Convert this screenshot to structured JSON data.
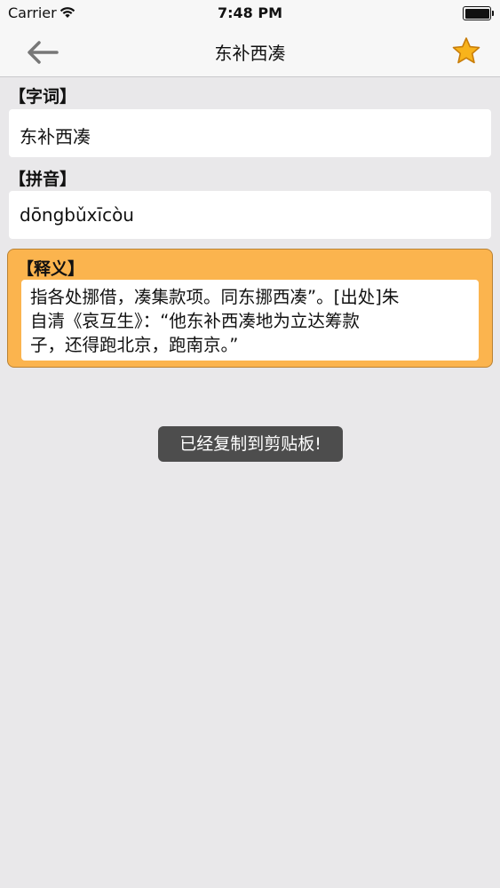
{
  "status_bar": {
    "carrier": "Carrier",
    "time": "7:48 PM"
  },
  "nav": {
    "title": "东补西凑",
    "back_icon": "back-arrow-icon",
    "star_icon": "star-icon",
    "star_color": "#f5a623"
  },
  "word": {
    "label": "【字词】",
    "value": "东补西凑"
  },
  "pinyin": {
    "label": "【拼音】",
    "value": "dōngbǔxīcòu"
  },
  "meaning": {
    "label": "【释义】",
    "lines": [
      "指各处挪借，凑集款项。同东挪西凑”。[出处]朱",
      "自清《哀互生》：“他东补西凑地为立达筹款",
      "子，还得跑北京，跑南京。”"
    ],
    "bg_color": "#fbb44e"
  },
  "toast": {
    "text": "已经复制到剪贴板!"
  }
}
